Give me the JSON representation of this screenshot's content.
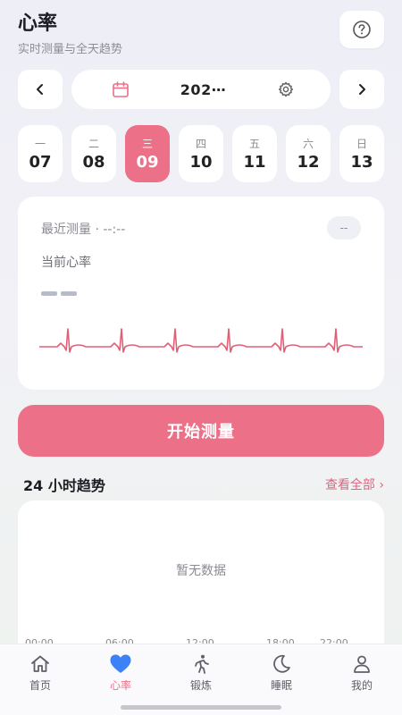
{
  "header": {
    "title": "心率",
    "subtitle": "实时测量与全天趋势"
  },
  "date_nav": {
    "date_text": "202⋯"
  },
  "week": [
    {
      "weekday": "一",
      "date": "07",
      "active": false
    },
    {
      "weekday": "二",
      "date": "08",
      "active": false
    },
    {
      "weekday": "三",
      "date": "09",
      "active": true
    },
    {
      "weekday": "四",
      "date": "10",
      "active": false
    },
    {
      "weekday": "五",
      "date": "11",
      "active": false
    },
    {
      "weekday": "六",
      "date": "12",
      "active": false
    },
    {
      "weekday": "日",
      "date": "13",
      "active": false
    }
  ],
  "measure_card": {
    "recent_text": "最近测量 · --:--",
    "badge": "--",
    "label": "当前心率"
  },
  "start_button": "开始测量",
  "trend": {
    "title": "24 小时趋势",
    "view_all": "查看全部 ›",
    "empty_text": "暂无数据",
    "time_labels": [
      "00:00",
      "06:00",
      "12:00",
      "18:00",
      "22:00"
    ]
  },
  "tabs": [
    {
      "label": "首页",
      "icon": "home-icon",
      "active": false
    },
    {
      "label": "心率",
      "icon": "heart-icon",
      "active": true
    },
    {
      "label": "锻炼",
      "icon": "running-icon",
      "active": false
    },
    {
      "label": "睡眠",
      "icon": "moon-icon",
      "active": false
    },
    {
      "label": "我的",
      "icon": "user-icon",
      "active": false
    }
  ],
  "colors": {
    "accent": "#ec7088",
    "ecg_line": "#e35f78"
  }
}
